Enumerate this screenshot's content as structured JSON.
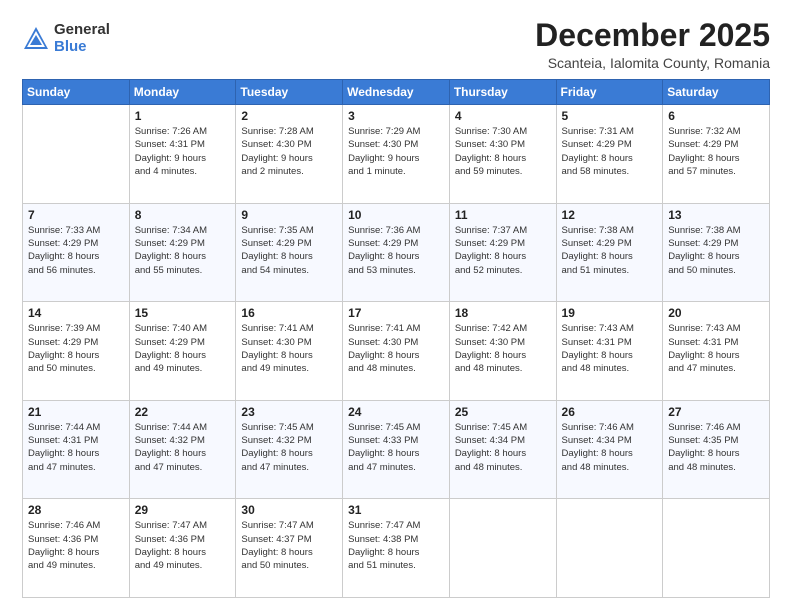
{
  "logo": {
    "general": "General",
    "blue": "Blue"
  },
  "header": {
    "title": "December 2025",
    "subtitle": "Scanteia, Ialomita County, Romania"
  },
  "weekdays": [
    "Sunday",
    "Monday",
    "Tuesday",
    "Wednesday",
    "Thursday",
    "Friday",
    "Saturday"
  ],
  "weeks": [
    [
      {
        "day": "",
        "info": ""
      },
      {
        "day": "1",
        "info": "Sunrise: 7:26 AM\nSunset: 4:31 PM\nDaylight: 9 hours\nand 4 minutes."
      },
      {
        "day": "2",
        "info": "Sunrise: 7:28 AM\nSunset: 4:30 PM\nDaylight: 9 hours\nand 2 minutes."
      },
      {
        "day": "3",
        "info": "Sunrise: 7:29 AM\nSunset: 4:30 PM\nDaylight: 9 hours\nand 1 minute."
      },
      {
        "day": "4",
        "info": "Sunrise: 7:30 AM\nSunset: 4:30 PM\nDaylight: 8 hours\nand 59 minutes."
      },
      {
        "day": "5",
        "info": "Sunrise: 7:31 AM\nSunset: 4:29 PM\nDaylight: 8 hours\nand 58 minutes."
      },
      {
        "day": "6",
        "info": "Sunrise: 7:32 AM\nSunset: 4:29 PM\nDaylight: 8 hours\nand 57 minutes."
      }
    ],
    [
      {
        "day": "7",
        "info": "Sunrise: 7:33 AM\nSunset: 4:29 PM\nDaylight: 8 hours\nand 56 minutes."
      },
      {
        "day": "8",
        "info": "Sunrise: 7:34 AM\nSunset: 4:29 PM\nDaylight: 8 hours\nand 55 minutes."
      },
      {
        "day": "9",
        "info": "Sunrise: 7:35 AM\nSunset: 4:29 PM\nDaylight: 8 hours\nand 54 minutes."
      },
      {
        "day": "10",
        "info": "Sunrise: 7:36 AM\nSunset: 4:29 PM\nDaylight: 8 hours\nand 53 minutes."
      },
      {
        "day": "11",
        "info": "Sunrise: 7:37 AM\nSunset: 4:29 PM\nDaylight: 8 hours\nand 52 minutes."
      },
      {
        "day": "12",
        "info": "Sunrise: 7:38 AM\nSunset: 4:29 PM\nDaylight: 8 hours\nand 51 minutes."
      },
      {
        "day": "13",
        "info": "Sunrise: 7:38 AM\nSunset: 4:29 PM\nDaylight: 8 hours\nand 50 minutes."
      }
    ],
    [
      {
        "day": "14",
        "info": "Sunrise: 7:39 AM\nSunset: 4:29 PM\nDaylight: 8 hours\nand 50 minutes."
      },
      {
        "day": "15",
        "info": "Sunrise: 7:40 AM\nSunset: 4:29 PM\nDaylight: 8 hours\nand 49 minutes."
      },
      {
        "day": "16",
        "info": "Sunrise: 7:41 AM\nSunset: 4:30 PM\nDaylight: 8 hours\nand 49 minutes."
      },
      {
        "day": "17",
        "info": "Sunrise: 7:41 AM\nSunset: 4:30 PM\nDaylight: 8 hours\nand 48 minutes."
      },
      {
        "day": "18",
        "info": "Sunrise: 7:42 AM\nSunset: 4:30 PM\nDaylight: 8 hours\nand 48 minutes."
      },
      {
        "day": "19",
        "info": "Sunrise: 7:43 AM\nSunset: 4:31 PM\nDaylight: 8 hours\nand 48 minutes."
      },
      {
        "day": "20",
        "info": "Sunrise: 7:43 AM\nSunset: 4:31 PM\nDaylight: 8 hours\nand 47 minutes."
      }
    ],
    [
      {
        "day": "21",
        "info": "Sunrise: 7:44 AM\nSunset: 4:31 PM\nDaylight: 8 hours\nand 47 minutes."
      },
      {
        "day": "22",
        "info": "Sunrise: 7:44 AM\nSunset: 4:32 PM\nDaylight: 8 hours\nand 47 minutes."
      },
      {
        "day": "23",
        "info": "Sunrise: 7:45 AM\nSunset: 4:32 PM\nDaylight: 8 hours\nand 47 minutes."
      },
      {
        "day": "24",
        "info": "Sunrise: 7:45 AM\nSunset: 4:33 PM\nDaylight: 8 hours\nand 47 minutes."
      },
      {
        "day": "25",
        "info": "Sunrise: 7:45 AM\nSunset: 4:34 PM\nDaylight: 8 hours\nand 48 minutes."
      },
      {
        "day": "26",
        "info": "Sunrise: 7:46 AM\nSunset: 4:34 PM\nDaylight: 8 hours\nand 48 minutes."
      },
      {
        "day": "27",
        "info": "Sunrise: 7:46 AM\nSunset: 4:35 PM\nDaylight: 8 hours\nand 48 minutes."
      }
    ],
    [
      {
        "day": "28",
        "info": "Sunrise: 7:46 AM\nSunset: 4:36 PM\nDaylight: 8 hours\nand 49 minutes."
      },
      {
        "day": "29",
        "info": "Sunrise: 7:47 AM\nSunset: 4:36 PM\nDaylight: 8 hours\nand 49 minutes."
      },
      {
        "day": "30",
        "info": "Sunrise: 7:47 AM\nSunset: 4:37 PM\nDaylight: 8 hours\nand 50 minutes."
      },
      {
        "day": "31",
        "info": "Sunrise: 7:47 AM\nSunset: 4:38 PM\nDaylight: 8 hours\nand 51 minutes."
      },
      {
        "day": "",
        "info": ""
      },
      {
        "day": "",
        "info": ""
      },
      {
        "day": "",
        "info": ""
      }
    ]
  ]
}
